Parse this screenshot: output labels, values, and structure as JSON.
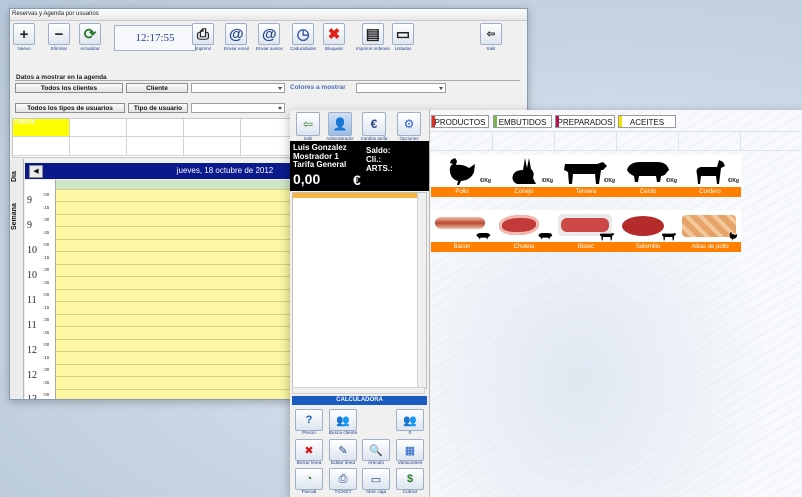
{
  "agenda": {
    "title": "Reservas y Agenda por usuarios",
    "toolbar": [
      {
        "label": "Nuevo",
        "icon": "plus-icon",
        "glyph": "+"
      },
      {
        "label": "Eliminar",
        "icon": "minus-icon",
        "glyph": "−"
      },
      {
        "label": "Actualizar",
        "icon": "refresh-icon",
        "glyph": "⟳"
      },
      {
        "label": "Imprimir",
        "icon": "printer-icon",
        "glyph": "⎙"
      },
      {
        "label": "Enviar email",
        "icon": "email-icon",
        "glyph": "@"
      },
      {
        "label": "Enviar avisos",
        "icon": "notify-icon",
        "glyph": "@"
      },
      {
        "label": "Caducidades",
        "icon": "clock-icon",
        "glyph": "◷"
      },
      {
        "label": "Bloquear",
        "icon": "block-icon",
        "glyph": "✖"
      },
      {
        "label": "Imprimir ordenes",
        "icon": "print-orders-icon",
        "glyph": "▤"
      },
      {
        "label": "Listados",
        "icon": "list-icon",
        "glyph": "▭"
      }
    ],
    "exit_label": "Salir",
    "clock": "12:17:55",
    "filter_section_label": "Datos a mostrar en la agenda",
    "todos_clientes": "Todos los clientes",
    "cliente_btn": "Cliente",
    "colores_label": "Colores a mostrar",
    "todos_tipos": "Todos los tipos de usuarios",
    "tipo_btn": "Tipo de usuario",
    "color_cell_label": "TODOS",
    "tab_dia": "Dia",
    "tab_semana": "Semana",
    "date": "jueves, 18 octubre de 2012",
    "hours": [
      "9",
      "9",
      "10",
      "10",
      "11",
      "11",
      "12",
      "12",
      "13"
    ],
    "minutes": [
      ":00",
      ":15",
      ":30",
      ":45",
      ":00",
      ":15",
      ":30",
      ":45",
      ":00",
      ":15",
      ":30",
      ":45",
      ":00",
      ":15",
      ":30",
      ":45",
      ":00"
    ]
  },
  "pos": {
    "toolbar": [
      {
        "label": "Salir",
        "icon": "exit-icon",
        "glyph": "⇦"
      },
      {
        "label": "Administrador",
        "icon": "admin-icon",
        "glyph": "👤"
      },
      {
        "label": "Cambio tarifa",
        "icon": "euro-icon",
        "glyph": "€"
      },
      {
        "label": "Opciones",
        "icon": "options-icon",
        "glyph": "⚙"
      }
    ],
    "user": "Luis Gonzalez",
    "counter": "Mostrador 1",
    "tariff": "Tarifa General",
    "total": "0,00",
    "currency": "€",
    "saldo_label": "Saldo:",
    "cli_label": "Cli.:",
    "arts_label": "ARTS.:",
    "calc_label": "CALCULADORA",
    "buttons_row1": [
      {
        "label": "Precio",
        "icon": "question-icon",
        "glyph": "?"
      },
      {
        "label": "Busca cliente",
        "icon": "search-client-icon",
        "glyph": "👥"
      },
      {
        "label": "0",
        "icon": "clients-icon",
        "glyph": "👥"
      }
    ],
    "buttons_row2": [
      {
        "label": "Borrar linea",
        "icon": "delete-line-icon",
        "glyph": "✖"
      },
      {
        "label": "Editar linea",
        "icon": "edit-line-icon",
        "glyph": "✎"
      },
      {
        "label": "Articulo",
        "icon": "article-icon",
        "glyph": "🔍"
      },
      {
        "label": "Variaciones",
        "icon": "variations-icon",
        "glyph": "▦"
      }
    ],
    "buttons_row3": [
      {
        "label": "Parcial",
        "icon": "partial-icon",
        "glyph": "◔"
      },
      {
        "label": "TICKET",
        "icon": "ticket-icon",
        "glyph": "⎙"
      },
      {
        "label": "Abrir caja",
        "icon": "cash-drawer-icon",
        "glyph": "▭"
      },
      {
        "label": "Cobrar",
        "icon": "charge-icon",
        "glyph": "$"
      }
    ],
    "categories": [
      {
        "label": "PRODUCTOS",
        "color": "#e03020"
      },
      {
        "label": "EMBUTIDOS",
        "color": "#7ab648"
      },
      {
        "label": "PREPARADOS",
        "color": "#b0144a"
      },
      {
        "label": "ACEITES",
        "color": "#f2e600"
      }
    ],
    "unit": "€/Kg",
    "products_row1": [
      {
        "name": "Pollo",
        "icon": "chicken-icon"
      },
      {
        "name": "Conejo",
        "icon": "rabbit-icon"
      },
      {
        "name": "Ternera",
        "icon": "cow-icon"
      },
      {
        "name": "Cerdo",
        "icon": "pig-icon"
      },
      {
        "name": "Cordero",
        "icon": "lamb-icon"
      }
    ],
    "products_row2": [
      {
        "name": "Bacon",
        "icon": "bacon-icon",
        "color": "#b8492f"
      },
      {
        "name": "Chuleta",
        "icon": "chop-icon",
        "color": "#c23a3a"
      },
      {
        "name": "Bistec",
        "icon": "steak-icon",
        "color": "#cf4848"
      },
      {
        "name": "Solomillo",
        "icon": "sirloin-icon",
        "color": "#b52b2b"
      },
      {
        "name": "Alitas de pollo",
        "icon": "wings-icon",
        "color": "#e6a36a"
      }
    ]
  }
}
